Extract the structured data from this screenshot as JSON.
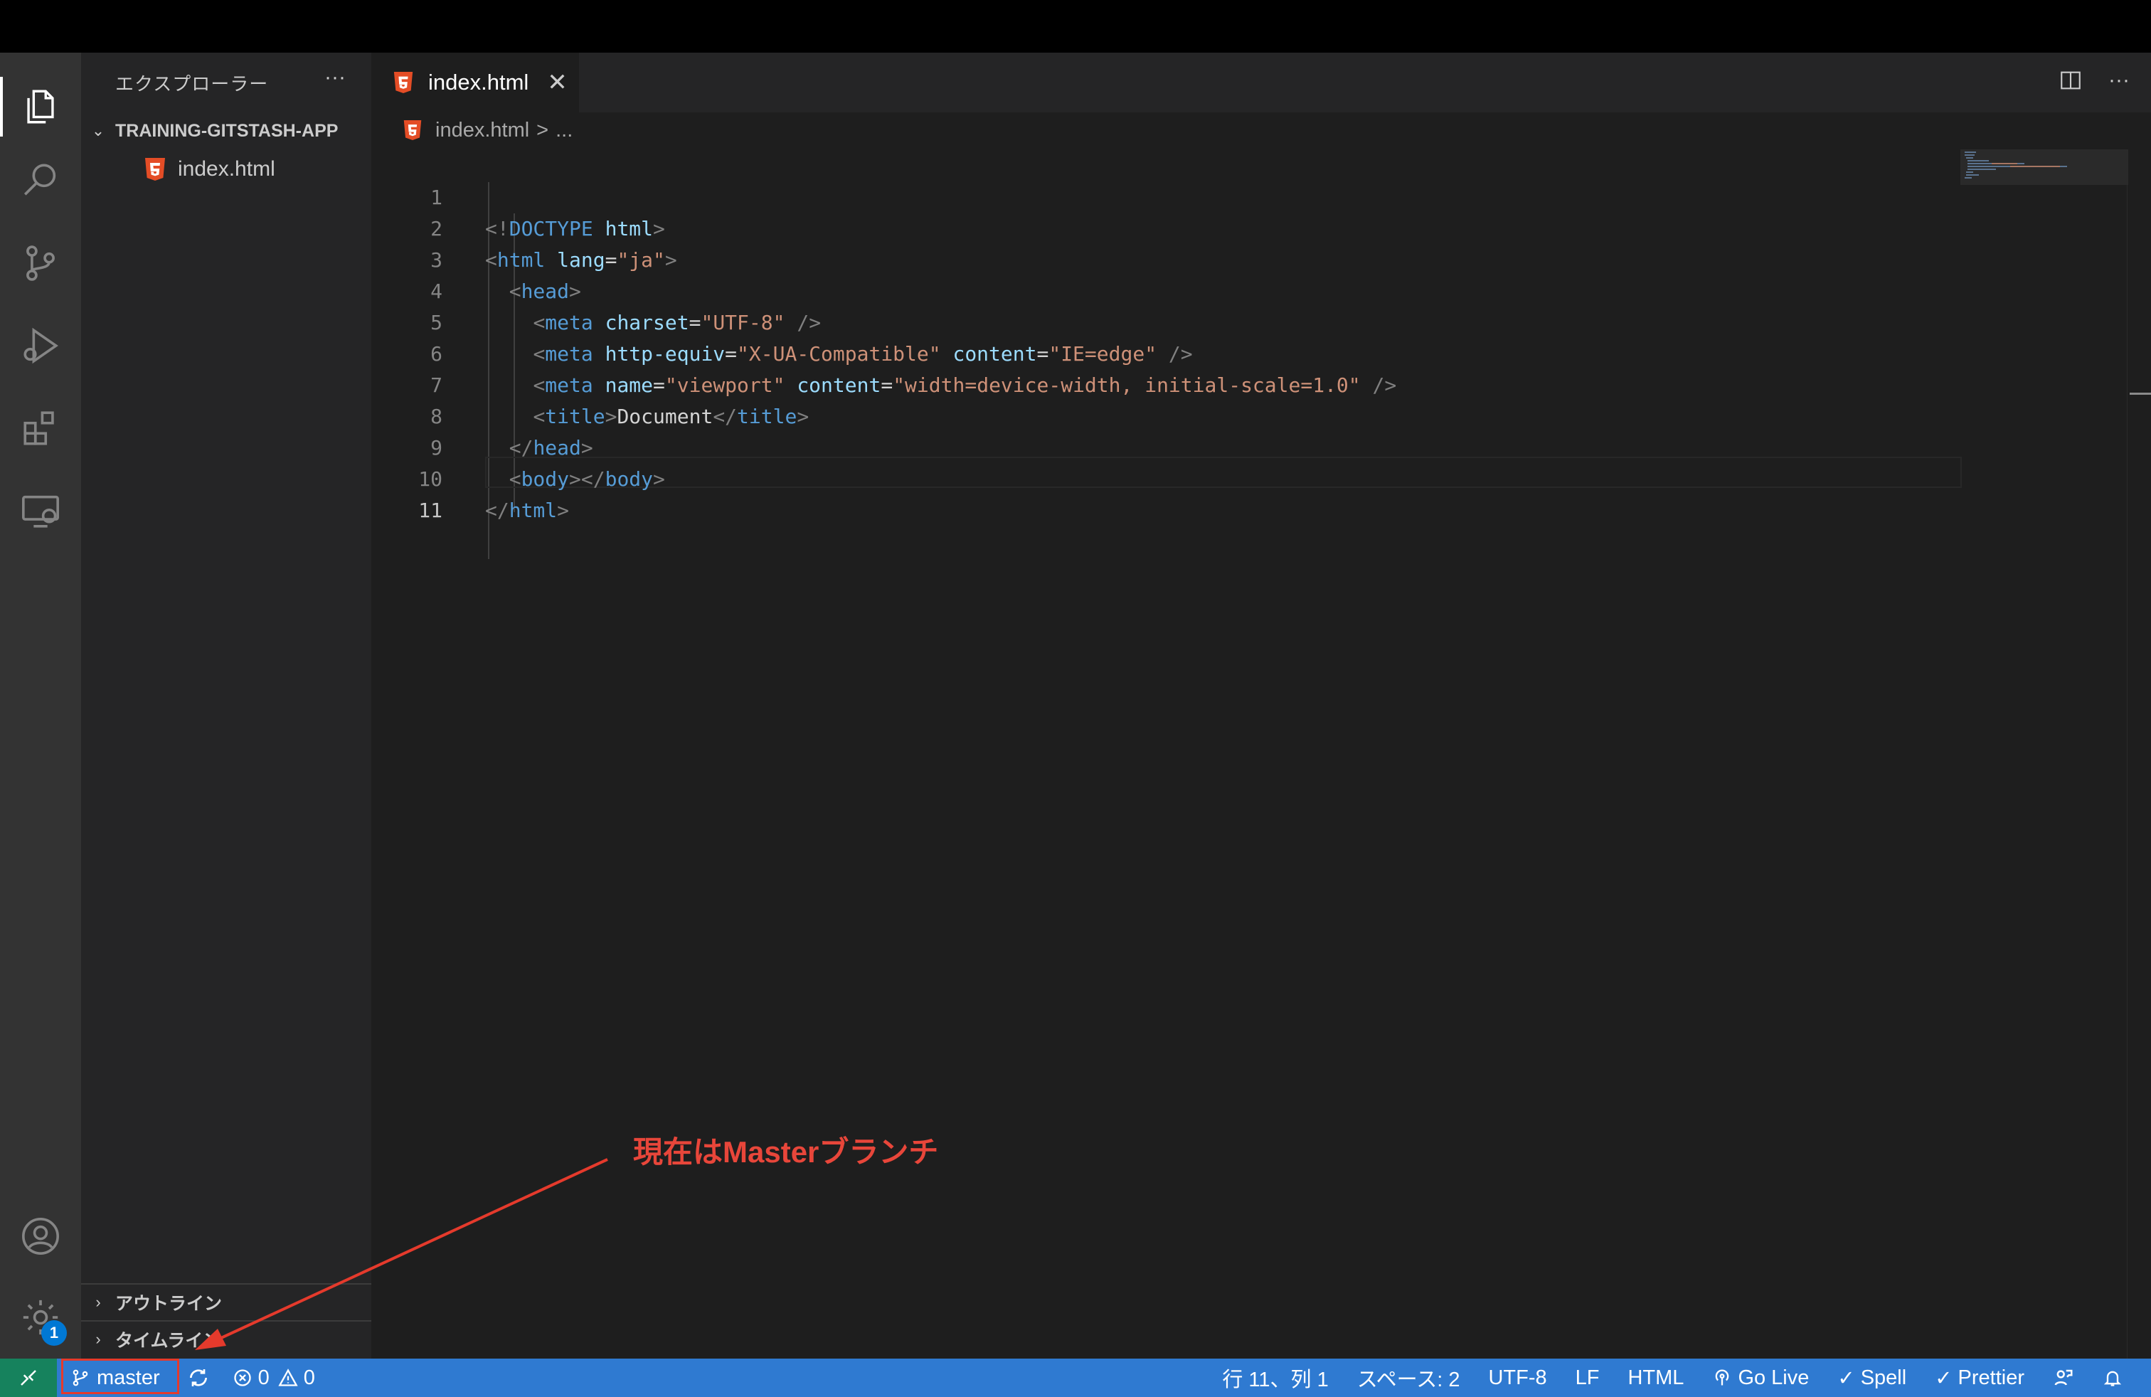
{
  "window": {
    "topbar_color": "#000000",
    "accent": "#2f7ad1"
  },
  "activity_bar": {
    "items": [
      {
        "icon": "files-icon",
        "active": true
      },
      {
        "icon": "search-icon"
      },
      {
        "icon": "source-control-icon"
      },
      {
        "icon": "run-debug-icon"
      },
      {
        "icon": "extensions-icon"
      },
      {
        "icon": "remote-explorer-icon"
      }
    ],
    "bottom": [
      {
        "icon": "account-icon"
      },
      {
        "icon": "gear-icon",
        "badge": "1"
      }
    ]
  },
  "sidebar": {
    "title": "エクスプローラー",
    "more": "···",
    "folder": "TRAINING-GITSTASH-APP",
    "files": [
      {
        "name": "index.html",
        "icon": "html5-icon"
      }
    ],
    "sections": [
      {
        "label": "アウトライン"
      },
      {
        "label": "タイムライン"
      }
    ]
  },
  "tabs": [
    {
      "label": "index.html",
      "close": "✕",
      "active": true
    }
  ],
  "editor_actions": {
    "split": "split-editor-icon",
    "more": "···"
  },
  "breadcrumb": {
    "file": "index.html",
    "sep": ">",
    "rest": "..."
  },
  "code": {
    "line_numbers": [
      "1",
      "2",
      "3",
      "4",
      "5",
      "6",
      "7",
      "8",
      "9",
      "10",
      "11"
    ],
    "current_line": 11
  },
  "annotation": {
    "text": "現在はMasterブランチ",
    "color": "#e8463a"
  },
  "statusbar": {
    "branch": "master",
    "errors": "0",
    "warnings": "0",
    "position": "行 11、列 1",
    "spaces": "スペース: 2",
    "encoding": "UTF-8",
    "eol": "LF",
    "language": "HTML",
    "golive": "Go Live",
    "spell": "Spell",
    "prettier": "Prettier"
  }
}
